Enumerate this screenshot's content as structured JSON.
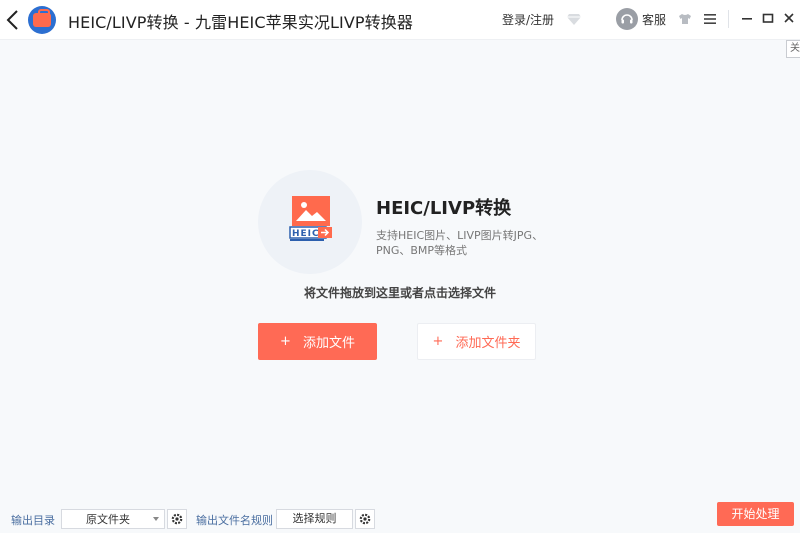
{
  "titlebar": {
    "title": "HEIC/LIVP转换 - 九雷HEIC苹果实况LIVP转换器",
    "login_label": "登录/注册",
    "service_label": "客服",
    "close_tooltip": "关闭"
  },
  "main": {
    "feature_title": "HEIC/LIVP转换",
    "feature_desc": "支持HEIC图片、LIVP图片转JPG、PNG、BMP等格式",
    "icon_label": "HEIC",
    "drop_hint": "将文件拖放到这里或者点击选择文件",
    "add_file_label": "添加文件",
    "add_folder_label": "添加文件夹",
    "plus": "+"
  },
  "bottom": {
    "output_dir_label": "输出目录",
    "output_dir_value": "原文件夹",
    "naming_rule_label": "输出文件名规则",
    "choose_rule_label": "选择规则",
    "start_label": "开始处理"
  },
  "colors": {
    "accent": "#ff6a55",
    "logo_blue": "#2c6fd1",
    "label_blue": "#4a6ea0"
  }
}
